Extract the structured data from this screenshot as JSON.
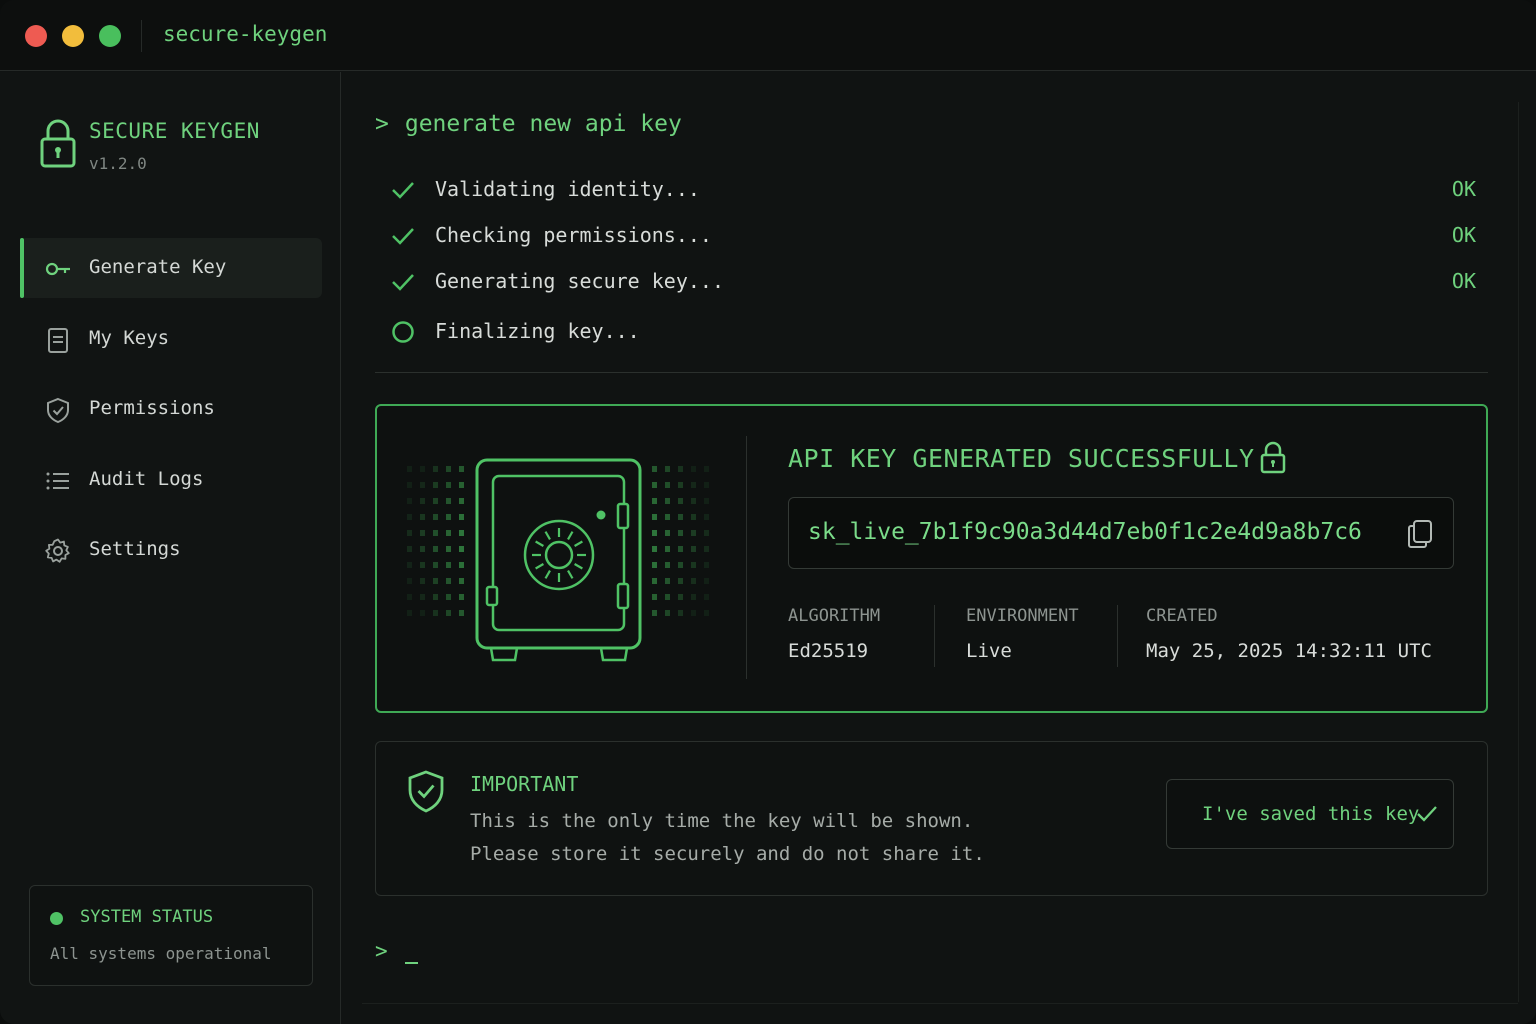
{
  "window": {
    "title": "secure-keygen"
  },
  "sidebar": {
    "brand": {
      "title": "SECURE KEYGEN",
      "version": "v1.2.0"
    },
    "items": [
      {
        "label": "Generate Key",
        "icon": "key-icon",
        "active": true
      },
      {
        "label": "My Keys",
        "icon": "document-icon",
        "active": false
      },
      {
        "label": "Permissions",
        "icon": "shield-check-icon",
        "active": false
      },
      {
        "label": "Audit Logs",
        "icon": "list-icon",
        "active": false
      },
      {
        "label": "Settings",
        "icon": "gear-icon",
        "active": false
      }
    ],
    "status": {
      "title": "SYSTEM STATUS",
      "text": "All systems operational"
    }
  },
  "main": {
    "prompt_symbol": ">",
    "command": "generate new api key",
    "steps": [
      {
        "label": "Validating identity...",
        "status": "OK",
        "icon": "check-icon"
      },
      {
        "label": "Checking permissions...",
        "status": "OK",
        "icon": "check-icon"
      },
      {
        "label": "Generating secure key...",
        "status": "OK",
        "icon": "check-icon"
      },
      {
        "label": "Finalizing key...",
        "status": "",
        "icon": "circle-icon"
      }
    ],
    "result": {
      "title": "API KEY GENERATED SUCCESSFULLY",
      "key": "sk_live_7b1f9c90a3d44d7eb0f1c2e4d9a8b7c6",
      "algorithm_label": "ALGORITHM",
      "algorithm": "Ed25519",
      "environment_label": "ENVIRONMENT",
      "environment": "Live",
      "created_label": "CREATED",
      "created": "May 25, 2025 14:32:11 UTC"
    },
    "important": {
      "title": "IMPORTANT",
      "line1": "This is the only time the key will be shown.",
      "line2": "Please store it securely and do not share it.",
      "button": "I've saved this key"
    },
    "input_prompt": ">"
  },
  "colors": {
    "accent": "#6fd27e",
    "accent_dark": "#3fa955",
    "background": "#101312",
    "text": "#d4d8d5",
    "muted": "#8d9490"
  }
}
